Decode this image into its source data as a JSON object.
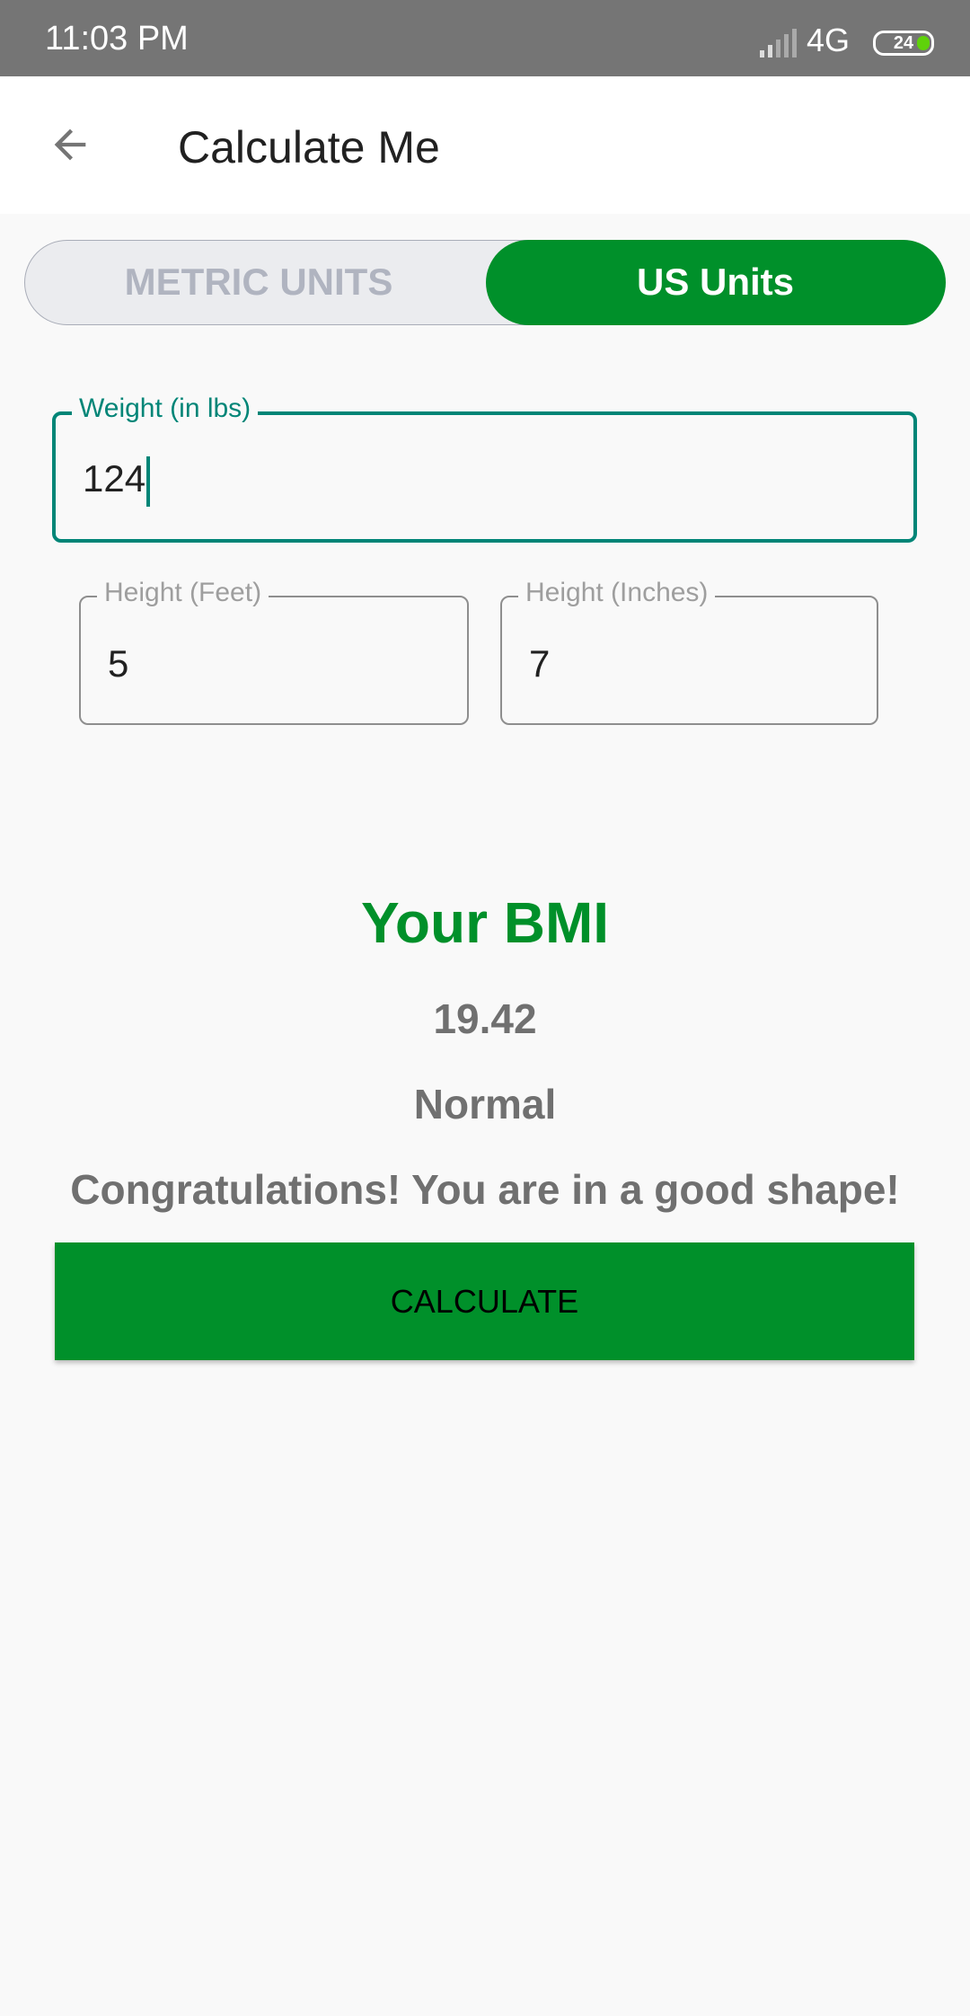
{
  "status_bar": {
    "time": "11:03 PM",
    "network": "4G",
    "battery": "24",
    "battery_color": "#5fd20a"
  },
  "app_bar": {
    "title": "Calculate Me",
    "back_icon": "arrow-left-icon"
  },
  "unit_toggle": {
    "options": [
      "METRIC UNITS",
      "US Units"
    ],
    "selected": "US Units",
    "accent": "#00902a"
  },
  "form": {
    "weight": {
      "label": "Weight (in lbs)",
      "value": "124",
      "focused": true,
      "focus_color": "#008577"
    },
    "height_feet": {
      "label": "Height (Feet)",
      "value": "5"
    },
    "height_inches": {
      "label": "Height (Inches)",
      "value": "7"
    }
  },
  "result": {
    "heading": "Your BMI",
    "bmi": "19.42",
    "category": "Normal",
    "message": "Congratulations! You are in a good shape!"
  },
  "calculate_label": "CALCULATE"
}
